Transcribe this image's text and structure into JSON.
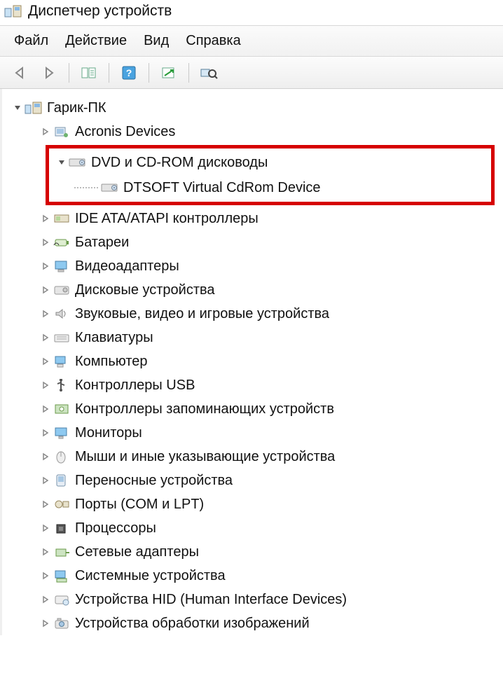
{
  "window": {
    "title": "Диспетчер устройств"
  },
  "menu": {
    "file": "Файл",
    "action": "Действие",
    "view": "Вид",
    "help": "Справка"
  },
  "tree": {
    "root": "Гарик-ПК",
    "items": [
      {
        "label": "Acronis Devices",
        "icon": "generic"
      },
      {
        "label": "DVD и CD-ROM дисководы",
        "icon": "cdrom",
        "expanded": true,
        "child": {
          "label": "DTSOFT Virtual CdRom Device",
          "icon": "cdrom"
        }
      },
      {
        "label": "IDE ATA/ATAPI контроллеры",
        "icon": "ide"
      },
      {
        "label": "Батареи",
        "icon": "battery"
      },
      {
        "label": "Видеоадаптеры",
        "icon": "display"
      },
      {
        "label": "Дисковые устройства",
        "icon": "disk"
      },
      {
        "label": "Звуковые, видео и игровые устройства",
        "icon": "sound"
      },
      {
        "label": "Клавиатуры",
        "icon": "keyboard"
      },
      {
        "label": "Компьютер",
        "icon": "computer"
      },
      {
        "label": "Контроллеры USB",
        "icon": "usb"
      },
      {
        "label": "Контроллеры запоминающих устройств",
        "icon": "storage"
      },
      {
        "label": "Мониторы",
        "icon": "monitor"
      },
      {
        "label": "Мыши и иные указывающие устройства",
        "icon": "mouse"
      },
      {
        "label": "Переносные устройства",
        "icon": "portable"
      },
      {
        "label": "Порты (COM и LPT)",
        "icon": "port"
      },
      {
        "label": "Процессоры",
        "icon": "cpu"
      },
      {
        "label": "Сетевые адаптеры",
        "icon": "network"
      },
      {
        "label": "Системные устройства",
        "icon": "system"
      },
      {
        "label": "Устройства HID (Human Interface Devices)",
        "icon": "hid"
      },
      {
        "label": "Устройства обработки изображений",
        "icon": "imaging"
      }
    ]
  }
}
